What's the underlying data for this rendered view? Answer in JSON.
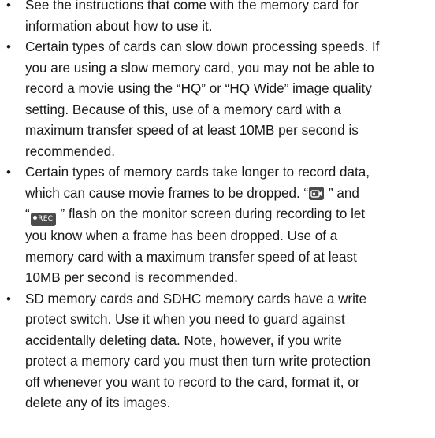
{
  "bullets": [
    {
      "lines": [
        "See the instructions that come with the memory card for",
        "information about how to use it."
      ]
    },
    {
      "lines": [
        "Certain types of cards can slow down processing speeds. If",
        "you are using a slow memory card, you may not be able to",
        "record a movie using the “HQ” or “HQ Wide” image quality",
        "setting. Because of this, use of a memory card with a",
        "maximum transfer speed of at least 10MB per second is",
        "recommended."
      ]
    },
    {
      "line1": "Certain types of memory cards take longer to record data,",
      "line2_pre": "which can cause movie frames to be dropped. “",
      "line2_mid": " ” and",
      "line3_pre": "“",
      "rec_label": "REC",
      "line3_post": " ” flash on the monitor screen during recording to let",
      "lines_rest": [
        "you know when a frame has been dropped. Use of a",
        "memory card with a maximum transfer speed of at least",
        "10MB per second is recommended."
      ]
    },
    {
      "lines": [
        "SD memory cards and SDHC memory cards have a write",
        "protect switch. Use it when you need to guard against",
        "accidentally deleting data. Note, however, if you write",
        "protect a memory card you must then turn write protection",
        "off whenever you want to record to the card, format it, or",
        "delete any of its images."
      ]
    }
  ],
  "icons": {
    "bullet_glyph": "•",
    "frame_drop_icon": "camera-frame-drop-icon",
    "rec_icon": "rec-indicator-icon"
  }
}
